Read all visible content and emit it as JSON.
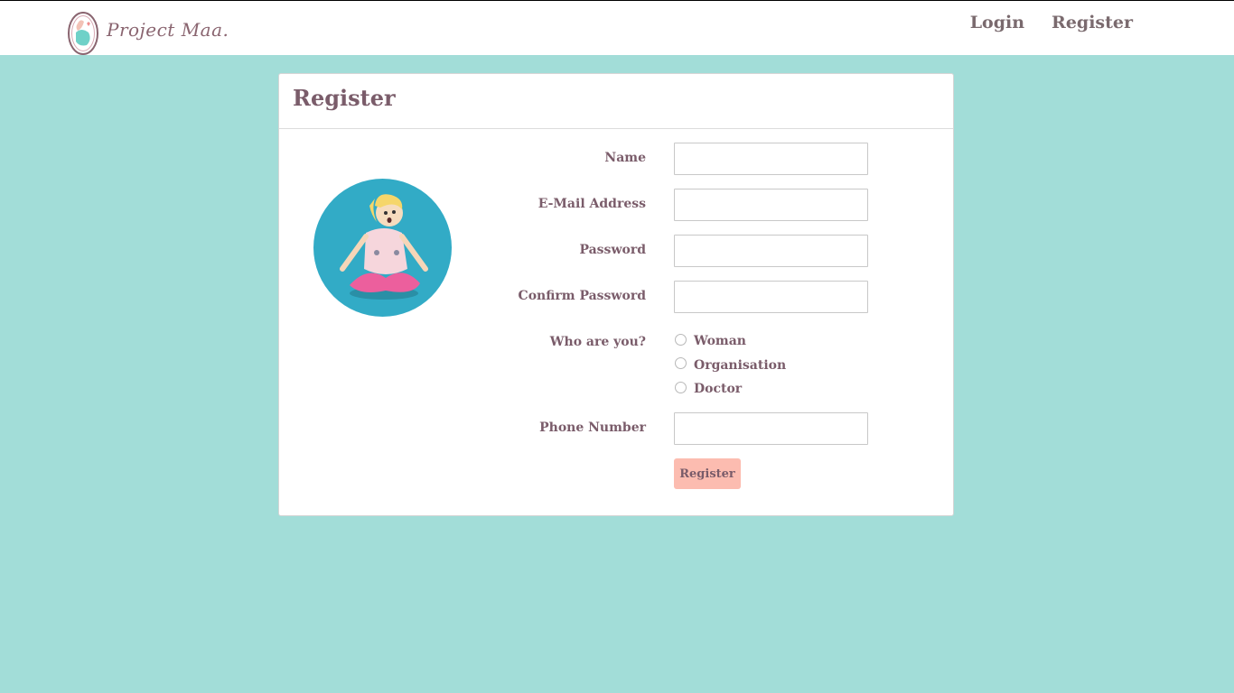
{
  "brand": {
    "name": "Project Maa."
  },
  "nav": {
    "login_label": "Login",
    "register_label": "Register"
  },
  "card": {
    "title": "Register"
  },
  "form": {
    "name_label": "Name",
    "email_label": "E-Mail Address",
    "password_label": "Password",
    "confirm_password_label": "Confirm Password",
    "who_label": "Who are you?",
    "role_options": [
      "Woman",
      "Organisation",
      "Doctor"
    ],
    "phone_label": "Phone Number",
    "submit_label": "Register",
    "name_value": "",
    "email_value": "",
    "password_value": "",
    "confirm_password_value": "",
    "phone_value": ""
  },
  "colors": {
    "page_background": "#a2ddd8",
    "text_accent": "#7a5c6a",
    "button_background": "#fcbcb0",
    "avatar_background": "#32abc6"
  }
}
